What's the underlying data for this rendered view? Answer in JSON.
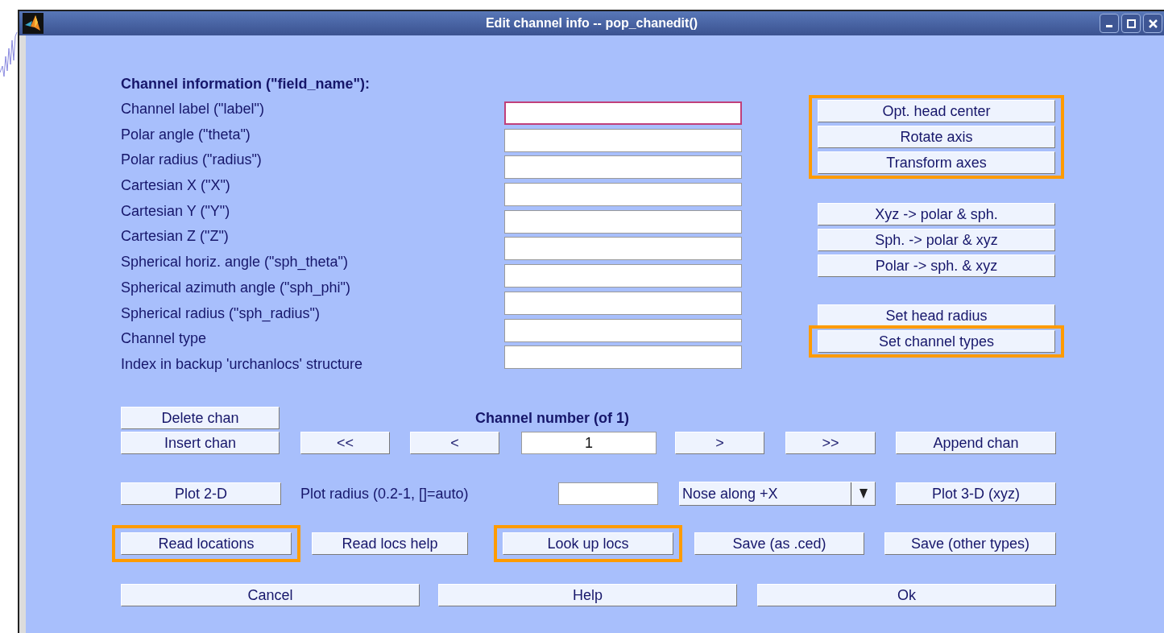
{
  "window": {
    "title": "Edit channel info -- pop_chanedit()"
  },
  "fields_header": "Channel information (\"field_name\"):",
  "fields": [
    {
      "label": "Channel label (\"label\")",
      "kind": "input",
      "focused": true
    },
    {
      "label": "Polar angle (\"theta\")",
      "kind": "input",
      "focused": false
    },
    {
      "label": "Polar radius (\"radius\")",
      "kind": "input",
      "focused": false
    },
    {
      "label": "Cartesian X (\"X\")",
      "kind": "input",
      "focused": false
    },
    {
      "label": "Cartesian Y (\"Y\")",
      "kind": "input",
      "focused": false
    },
    {
      "label": "Cartesian Z (\"Z\")",
      "kind": "input",
      "focused": false
    },
    {
      "label": "Spherical horiz. angle (\"sph_theta\")",
      "kind": "input",
      "focused": false
    },
    {
      "label": "Spherical azimuth angle (\"sph_phi\")",
      "kind": "input",
      "focused": false
    },
    {
      "label": "Spherical radius (\"sph_radius\")",
      "kind": "input",
      "focused": false
    },
    {
      "label": "Channel type",
      "kind": "input",
      "focused": false
    },
    {
      "label": "Index in backup 'urchanlocs' structure",
      "kind": "text"
    }
  ],
  "side_buttons": [
    [
      {
        "label": "Opt. head center",
        "highlighted": true
      },
      {
        "label": "Rotate axis",
        "highlighted": true
      },
      {
        "label": "Transform axes",
        "highlighted": true
      }
    ],
    [
      {
        "label": "Xyz -> polar & sph.",
        "highlighted": false
      },
      {
        "label": "Sph. -> polar & xyz",
        "highlighted": false
      },
      {
        "label": "Polar -> sph. & xyz",
        "highlighted": false
      }
    ],
    [
      {
        "label": "Set head radius",
        "highlighted": false
      },
      {
        "label": "Set channel types",
        "highlighted": true
      }
    ]
  ],
  "rows": [
    [
      {
        "kind": "button",
        "label": "Delete chan",
        "highlighted": false
      },
      {
        "kind": "title",
        "label": "Channel number (of 1)"
      }
    ],
    [
      {
        "kind": "button",
        "label": "Insert chan",
        "highlighted": false
      },
      {
        "kind": "button",
        "label": "<<",
        "highlighted": false
      },
      {
        "kind": "button",
        "label": "<",
        "highlighted": false
      },
      {
        "kind": "input",
        "value": "1"
      },
      {
        "kind": "button",
        "label": ">",
        "highlighted": false
      },
      {
        "kind": "button",
        "label": ">>",
        "highlighted": false
      },
      {
        "kind": "button",
        "label": "Append chan",
        "highlighted": false
      }
    ],
    [
      {
        "kind": "button",
        "label": "Plot 2-D",
        "highlighted": false
      },
      {
        "kind": "text",
        "label": "Plot radius (0.2-1, []=auto)"
      },
      {
        "kind": "input"
      },
      {
        "kind": "dropdown",
        "value": "Nose along +X"
      },
      {
        "kind": "button",
        "label": "Plot 3-D (xyz)",
        "highlighted": false
      }
    ],
    [
      {
        "kind": "button",
        "label": "Read locations",
        "highlighted": true
      },
      {
        "kind": "button",
        "label": "Read locs help",
        "highlighted": false
      },
      {
        "kind": "button",
        "label": "Look up locs",
        "highlighted": true
      },
      {
        "kind": "button",
        "label": "Save (as .ced)",
        "highlighted": false
      },
      {
        "kind": "button",
        "label": "Save (other types)",
        "highlighted": false
      }
    ],
    [
      {
        "kind": "button",
        "label": "Cancel",
        "highlighted": false
      },
      {
        "kind": "button",
        "label": "Help",
        "highlighted": false
      },
      {
        "kind": "button",
        "label": "Ok",
        "highlighted": false
      }
    ]
  ]
}
